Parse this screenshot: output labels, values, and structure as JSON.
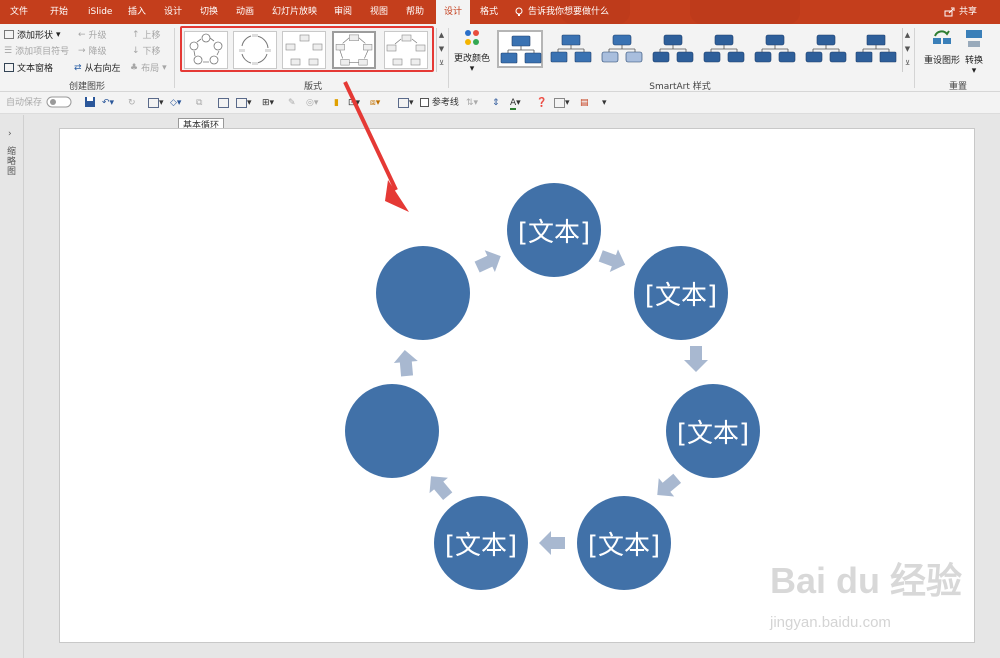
{
  "menubar": {
    "tabs": [
      "文件",
      "开始",
      "iSlide",
      "插入",
      "设计",
      "切换",
      "动画",
      "幻灯片放映",
      "审阅",
      "视图",
      "帮助",
      "设计",
      "格式"
    ],
    "active_tab": "设计",
    "tell_me": "告诉我你想要做什么",
    "share": "共享"
  },
  "ribbon": {
    "create_graphic": {
      "label": "创建图形",
      "add_shape": "添加形状",
      "add_bullet": "添加项目符号",
      "text_pane": "文本窗格",
      "promote": "升级",
      "demote": "降级",
      "right_to_left": "从右向左",
      "move_up": "上移",
      "move_down": "下移",
      "layout": "布局"
    },
    "layouts": {
      "label": "版式",
      "selected_index": 3
    },
    "smartart_styles": {
      "label": "SmartArt 样式",
      "change_colors": "更改颜色",
      "selected_index": 0
    },
    "reset": {
      "label": "重置",
      "reset_graphic": "重设图形",
      "convert": "转换"
    }
  },
  "qat": {
    "autosave": "自动保存",
    "guides": "参考线"
  },
  "tooltip": "基本循环",
  "leftpane": {
    "label": "缩略图"
  },
  "diagram": {
    "fill_color": "#4171a8",
    "arrow_color": "#a8b8d0",
    "nodes": [
      "[文本]",
      "[文本]",
      "[文本]",
      "[文本]",
      "[文本]",
      "",
      ""
    ]
  },
  "annotation": {
    "color": "#e53935"
  },
  "watermark": {
    "logo": "Bai du 经验",
    "url": "jingyan.baidu.com"
  }
}
